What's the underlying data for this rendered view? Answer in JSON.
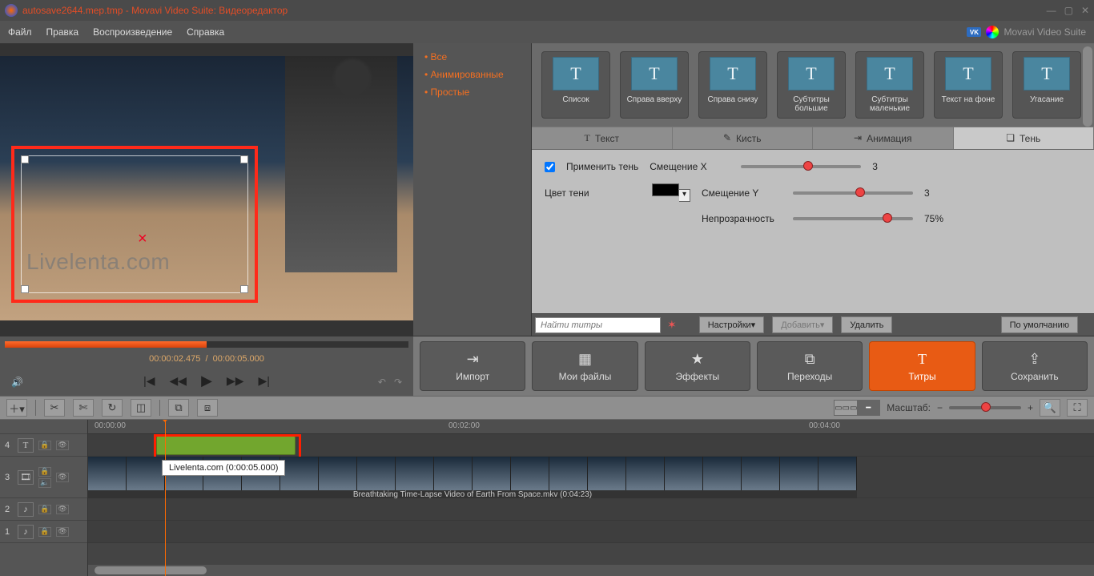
{
  "titlebar": {
    "file": "autosave2644.mep.tmp",
    "app": "Movavi Video Suite: Видеоредактор"
  },
  "menu": {
    "file": "Файл",
    "edit": "Правка",
    "playback": "Воспроизведение",
    "help": "Справка",
    "brand": "Movavi Video Suite"
  },
  "categories": [
    "Все",
    "Анимированные",
    "Простые"
  ],
  "presets": [
    {
      "label": "Список"
    },
    {
      "label": "Справа вверху"
    },
    {
      "label": "Справа снизу"
    },
    {
      "label": "Субтитры большие"
    },
    {
      "label": "Субтитры маленькие"
    },
    {
      "label": "Текст на фоне"
    },
    {
      "label": "Угасание"
    }
  ],
  "titletabs": {
    "text": "Текст",
    "brush": "Кисть",
    "anim": "Анимация",
    "shadow": "Тень"
  },
  "shadow": {
    "apply": "Применить тень",
    "color": "Цвет тени",
    "offx": "Смещение X",
    "offx_val": "3",
    "offy": "Смещение Y",
    "offy_val": "3",
    "opacity": "Непрозрачность",
    "opacity_val": "75%"
  },
  "search": {
    "placeholder": "Найти титры",
    "settings": "Настройки",
    "add": "Добавить",
    "remove": "Удалить",
    "reset": "По умолчанию"
  },
  "transport": {
    "cur": "00:00:02.475",
    "dur": "00:00:05.000"
  },
  "bigtabs": {
    "import": "Импорт",
    "files": "Мои файлы",
    "effects": "Эффекты",
    "trans": "Переходы",
    "titles": "Титры",
    "save": "Сохранить"
  },
  "scale": {
    "label": "Масштаб:"
  },
  "ruler": {
    "t0": "00:00:00",
    "t1": "00:02:00",
    "t2": "00:04:00"
  },
  "preview_text": "Livelenta.com",
  "tooltip": "Livelenta.com  (0:00:05.000)",
  "videoclip": "Breathtaking Time-Lapse Video of Earth From Space.mkv (0:04:23)",
  "tracks": {
    "n4": "4",
    "n3": "3",
    "n2": "2",
    "n1": "1"
  }
}
